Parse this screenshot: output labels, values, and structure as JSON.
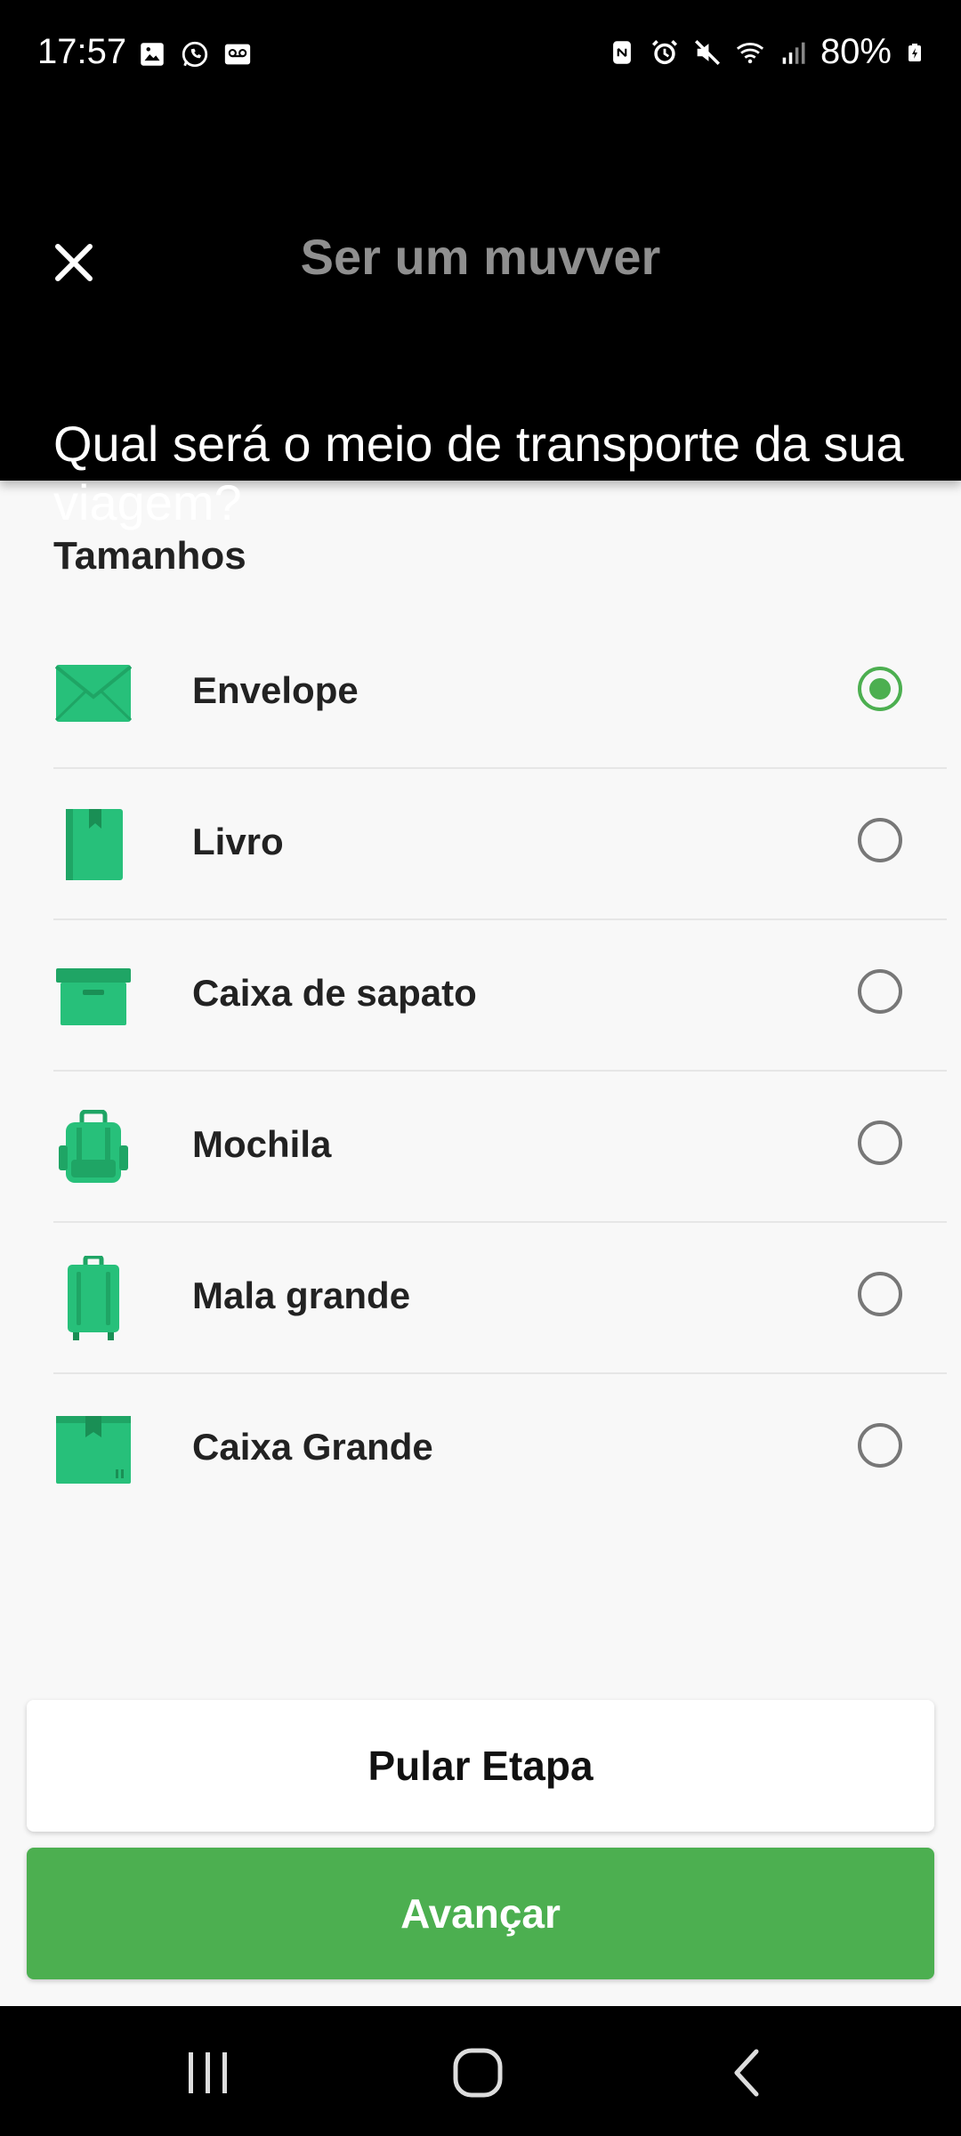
{
  "status_bar": {
    "time": "17:57",
    "left_icons": [
      "gallery-icon",
      "whatsapp-icon",
      "voicemail-icon"
    ],
    "right_icons": [
      "nfc-icon",
      "alarm-icon",
      "mute-icon",
      "wifi-icon",
      "signal-icon",
      "battery-icon"
    ],
    "battery": "80%"
  },
  "header": {
    "close_icon": "close-icon",
    "title": "Ser um muvver",
    "question": "Qual será o meio de transporte da sua viagem?"
  },
  "section": {
    "title": "Tamanhos",
    "items": [
      {
        "label": "Envelope",
        "icon": "envelope-icon",
        "selected": true
      },
      {
        "label": "Livro",
        "icon": "book-icon",
        "selected": false
      },
      {
        "label": "Caixa de sapato",
        "icon": "shoebox-icon",
        "selected": false
      },
      {
        "label": "Mochila",
        "icon": "backpack-icon",
        "selected": false
      },
      {
        "label": "Mala grande",
        "icon": "suitcase-icon",
        "selected": false
      },
      {
        "label": "Caixa Grande",
        "icon": "big-box-icon",
        "selected": false
      }
    ]
  },
  "buttons": {
    "skip_label": "Pular Etapa",
    "next_label": "Avançar"
  },
  "nav": {
    "recents": "recents-icon",
    "home": "home-icon",
    "back": "back-icon"
  },
  "colors": {
    "accent": "#4caf50",
    "icon_green": "#2ecc71",
    "header_bg": "#000000"
  }
}
